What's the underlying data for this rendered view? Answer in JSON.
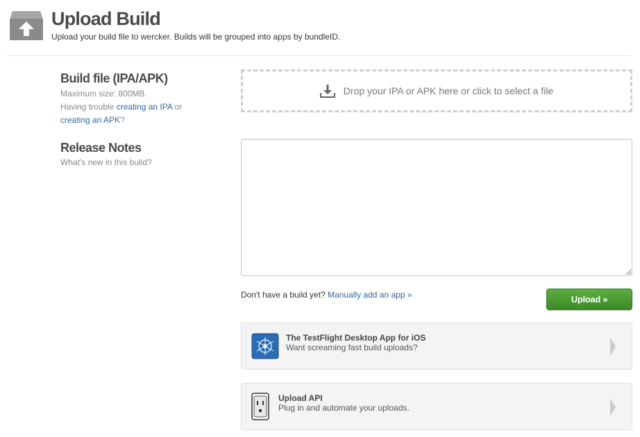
{
  "header": {
    "icon": "upload-box-icon",
    "title": "Upload Build",
    "subtitle": "Upload your build file to wercker. Builds will be grouped into apps by bundleID."
  },
  "build_file": {
    "title": "Build file (IPA/APK)",
    "max_size": "Maximum size: 800MB.",
    "trouble_prefix": "Having trouble ",
    "ipa_link": "creating an IPA",
    "or_text": " or",
    "apk_link": "creating an APK",
    "question_mark": "?",
    "dropzone_icon": "download-icon",
    "dropzone_text": "Drop your IPA or APK here or click to select a file"
  },
  "release_notes": {
    "title": "Release Notes",
    "help": "What's new in this build?",
    "value": ""
  },
  "footer_actions": {
    "no_build_text": "Don't have a build yet?",
    "manual_link": "Manually add an app »",
    "upload_label": "Upload »"
  },
  "promos": [
    {
      "icon": "testflight-app-icon",
      "title": "The TestFlight Desktop App for iOS",
      "desc": "Want screaming fast build uploads?"
    },
    {
      "icon": "power-outlet-icon",
      "title": "Upload API",
      "desc": "Plug in and automate your uploads."
    }
  ],
  "colors": {
    "link": "#2b6aa8",
    "upload_button": "#4a9a32",
    "testflight_blue": "#2a6db5"
  }
}
